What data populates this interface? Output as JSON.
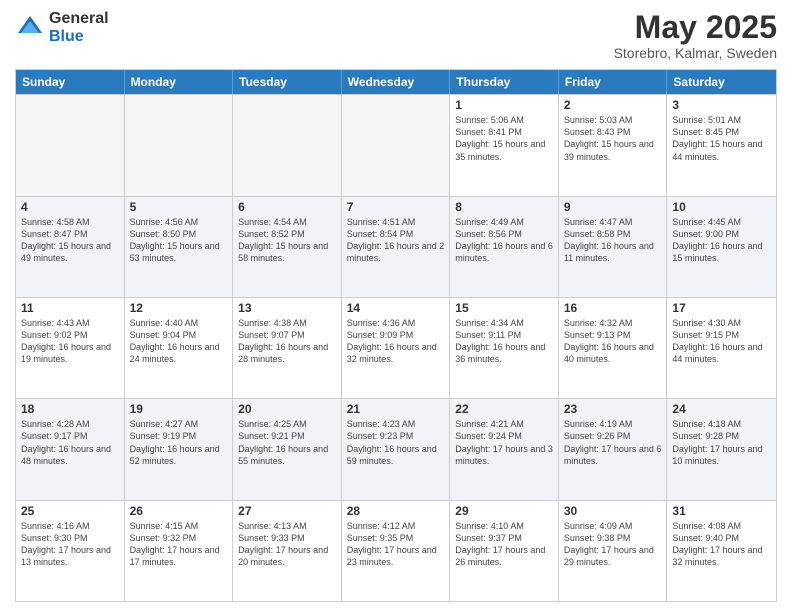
{
  "logo": {
    "general": "General",
    "blue": "Blue"
  },
  "header": {
    "title": "May 2025",
    "subtitle": "Storebro, Kalmar, Sweden"
  },
  "weekdays": [
    "Sunday",
    "Monday",
    "Tuesday",
    "Wednesday",
    "Thursday",
    "Friday",
    "Saturday"
  ],
  "rows": [
    {
      "cells": [
        {
          "day": "",
          "empty": true
        },
        {
          "day": "",
          "empty": true
        },
        {
          "day": "",
          "empty": true
        },
        {
          "day": "",
          "empty": true
        },
        {
          "day": "1",
          "sunrise": "5:06 AM",
          "sunset": "8:41 PM",
          "daylight": "15 hours and 35 minutes."
        },
        {
          "day": "2",
          "sunrise": "5:03 AM",
          "sunset": "8:43 PM",
          "daylight": "15 hours and 39 minutes."
        },
        {
          "day": "3",
          "sunrise": "5:01 AM",
          "sunset": "8:45 PM",
          "daylight": "15 hours and 44 minutes."
        }
      ]
    },
    {
      "alt": true,
      "cells": [
        {
          "day": "4",
          "sunrise": "4:58 AM",
          "sunset": "8:47 PM",
          "daylight": "15 hours and 49 minutes."
        },
        {
          "day": "5",
          "sunrise": "4:56 AM",
          "sunset": "8:50 PM",
          "daylight": "15 hours and 53 minutes."
        },
        {
          "day": "6",
          "sunrise": "4:54 AM",
          "sunset": "8:52 PM",
          "daylight": "15 hours and 58 minutes."
        },
        {
          "day": "7",
          "sunrise": "4:51 AM",
          "sunset": "8:54 PM",
          "daylight": "16 hours and 2 minutes."
        },
        {
          "day": "8",
          "sunrise": "4:49 AM",
          "sunset": "8:56 PM",
          "daylight": "16 hours and 6 minutes."
        },
        {
          "day": "9",
          "sunrise": "4:47 AM",
          "sunset": "8:58 PM",
          "daylight": "16 hours and 11 minutes."
        },
        {
          "day": "10",
          "sunrise": "4:45 AM",
          "sunset": "9:00 PM",
          "daylight": "16 hours and 15 minutes."
        }
      ]
    },
    {
      "cells": [
        {
          "day": "11",
          "sunrise": "4:43 AM",
          "sunset": "9:02 PM",
          "daylight": "16 hours and 19 minutes."
        },
        {
          "day": "12",
          "sunrise": "4:40 AM",
          "sunset": "9:04 PM",
          "daylight": "16 hours and 24 minutes."
        },
        {
          "day": "13",
          "sunrise": "4:38 AM",
          "sunset": "9:07 PM",
          "daylight": "16 hours and 28 minutes."
        },
        {
          "day": "14",
          "sunrise": "4:36 AM",
          "sunset": "9:09 PM",
          "daylight": "16 hours and 32 minutes."
        },
        {
          "day": "15",
          "sunrise": "4:34 AM",
          "sunset": "9:11 PM",
          "daylight": "16 hours and 36 minutes."
        },
        {
          "day": "16",
          "sunrise": "4:32 AM",
          "sunset": "9:13 PM",
          "daylight": "16 hours and 40 minutes."
        },
        {
          "day": "17",
          "sunrise": "4:30 AM",
          "sunset": "9:15 PM",
          "daylight": "16 hours and 44 minutes."
        }
      ]
    },
    {
      "alt": true,
      "cells": [
        {
          "day": "18",
          "sunrise": "4:28 AM",
          "sunset": "9:17 PM",
          "daylight": "16 hours and 48 minutes."
        },
        {
          "day": "19",
          "sunrise": "4:27 AM",
          "sunset": "9:19 PM",
          "daylight": "16 hours and 52 minutes."
        },
        {
          "day": "20",
          "sunrise": "4:25 AM",
          "sunset": "9:21 PM",
          "daylight": "16 hours and 55 minutes."
        },
        {
          "day": "21",
          "sunrise": "4:23 AM",
          "sunset": "9:23 PM",
          "daylight": "16 hours and 59 minutes."
        },
        {
          "day": "22",
          "sunrise": "4:21 AM",
          "sunset": "9:24 PM",
          "daylight": "17 hours and 3 minutes."
        },
        {
          "day": "23",
          "sunrise": "4:19 AM",
          "sunset": "9:26 PM",
          "daylight": "17 hours and 6 minutes."
        },
        {
          "day": "24",
          "sunrise": "4:18 AM",
          "sunset": "9:28 PM",
          "daylight": "17 hours and 10 minutes."
        }
      ]
    },
    {
      "cells": [
        {
          "day": "25",
          "sunrise": "4:16 AM",
          "sunset": "9:30 PM",
          "daylight": "17 hours and 13 minutes."
        },
        {
          "day": "26",
          "sunrise": "4:15 AM",
          "sunset": "9:32 PM",
          "daylight": "17 hours and 17 minutes."
        },
        {
          "day": "27",
          "sunrise": "4:13 AM",
          "sunset": "9:33 PM",
          "daylight": "17 hours and 20 minutes."
        },
        {
          "day": "28",
          "sunrise": "4:12 AM",
          "sunset": "9:35 PM",
          "daylight": "17 hours and 23 minutes."
        },
        {
          "day": "29",
          "sunrise": "4:10 AM",
          "sunset": "9:37 PM",
          "daylight": "17 hours and 26 minutes."
        },
        {
          "day": "30",
          "sunrise": "4:09 AM",
          "sunset": "9:38 PM",
          "daylight": "17 hours and 29 minutes."
        },
        {
          "day": "31",
          "sunrise": "4:08 AM",
          "sunset": "9:40 PM",
          "daylight": "17 hours and 32 minutes."
        }
      ]
    }
  ],
  "labels": {
    "sunrise_prefix": "Sunrise: ",
    "sunset_prefix": "Sunset: ",
    "daylight_prefix": "Daylight: "
  }
}
